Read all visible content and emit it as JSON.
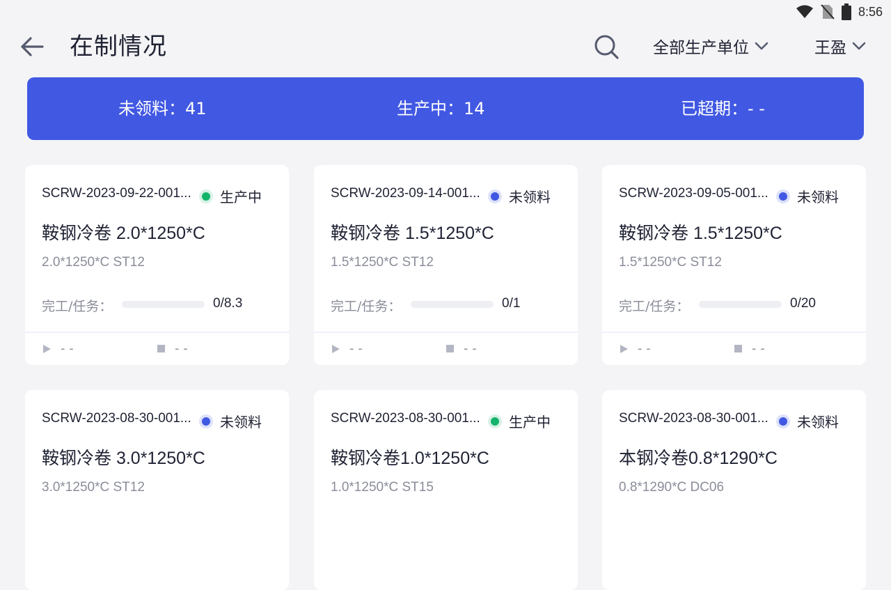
{
  "status_bar": {
    "time": "8:56"
  },
  "header": {
    "title": "在制情况",
    "unit_filter": "全部生产单位",
    "user": "王盈"
  },
  "summary": {
    "not_received": "未领料：41",
    "in_production": "生产中：14",
    "overdue": "已超期：- -"
  },
  "progress_label": "完工/任务：",
  "cards": [
    {
      "code": "SCRW-2023-09-22-001...",
      "status": "生产中",
      "status_color": "#14b36b",
      "name": "鞍钢冷卷 2.0*1250*C",
      "spec": "2.0*1250*C ST12",
      "completed": 0,
      "task": 8.3,
      "progress": "0/8.3",
      "start": "- -",
      "end": "- -"
    },
    {
      "code": "SCRW-2023-09-14-001...",
      "status": "未领料",
      "status_color": "#4158e3",
      "name": "鞍钢冷卷 1.5*1250*C",
      "spec": "1.5*1250*C ST12",
      "completed": 0,
      "task": 1,
      "progress": "0/1",
      "start": "- -",
      "end": "- -"
    },
    {
      "code": "SCRW-2023-09-05-001...",
      "status": "未领料",
      "status_color": "#4158e3",
      "name": "鞍钢冷卷 1.5*1250*C",
      "spec": "1.5*1250*C ST12",
      "completed": 0,
      "task": 20,
      "progress": "0/20",
      "start": "- -",
      "end": "- -"
    },
    {
      "code": "SCRW-2023-08-30-001...",
      "status": "未领料",
      "status_color": "#4158e3",
      "name": "鞍钢冷卷 3.0*1250*C",
      "spec": "3.0*1250*C ST12",
      "completed": null,
      "task": null,
      "progress": "",
      "start": "",
      "end": ""
    },
    {
      "code": "SCRW-2023-08-30-001...",
      "status": "生产中",
      "status_color": "#14b36b",
      "name": "鞍钢冷卷1.0*1250*C",
      "spec": "1.0*1250*C ST15",
      "completed": null,
      "task": null,
      "progress": "",
      "start": "",
      "end": ""
    },
    {
      "code": "SCRW-2023-08-30-001...",
      "status": "未领料",
      "status_color": "#4158e3",
      "name": "本钢冷卷0.8*1290*C",
      "spec": "0.8*1290*C DC06",
      "completed": null,
      "task": null,
      "progress": "",
      "start": "",
      "end": ""
    }
  ]
}
